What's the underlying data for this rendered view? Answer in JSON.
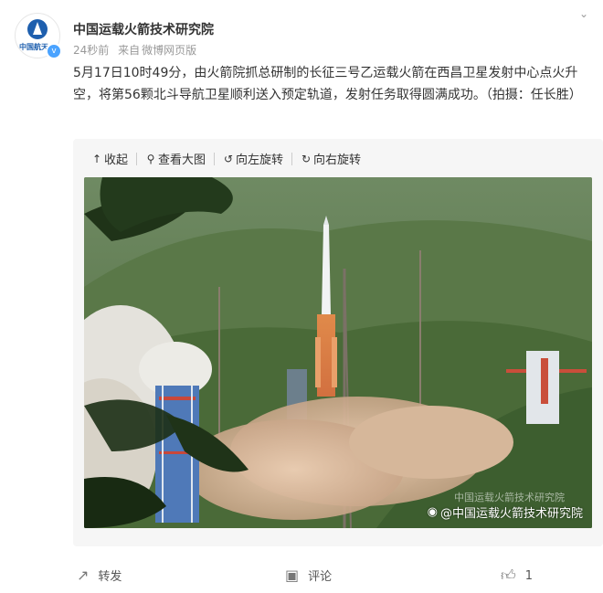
{
  "header": {
    "avatar_text": "中国航天",
    "verified_badge": "v",
    "username": "中国运载火箭技术研究院",
    "time": "24秒前",
    "source_prefix": "来自",
    "source": "微博网页版"
  },
  "post": {
    "text": "5月17日10时49分，由火箭院抓总研制的长征三号乙运载火箭在西昌卫星发射中心点火升空，将第56颗北斗导航卫星顺利送入预定轨道，发射任务取得圆满成功。（拍摄：任长胜）"
  },
  "toolbar": {
    "collapse_label": "收起",
    "collapse_icon": "arrow-up-icon",
    "view_large_label": "查看大图",
    "view_large_icon": "magnifier-icon",
    "rotate_left_label": "向左旋转",
    "rotate_left_icon": "rotate-left-icon",
    "rotate_right_label": "向右旋转",
    "rotate_right_icon": "rotate-right-icon"
  },
  "image": {
    "watermark": "@中国运载火箭技术研究院",
    "watermark_faint": "中国运载火箭技术研究院",
    "description_icon": "weibo-icon"
  },
  "actions": {
    "share_label": "转发",
    "share_icon": "share-icon",
    "comment_label": "评论",
    "comment_icon": "comment-icon",
    "like_count": "1",
    "like_icon": "thumbs-up-icon"
  },
  "colors": {
    "username": "#333333",
    "meta": "#999999",
    "card_bg": "#f6f6f6",
    "brand_blue": "#1e5fae"
  }
}
